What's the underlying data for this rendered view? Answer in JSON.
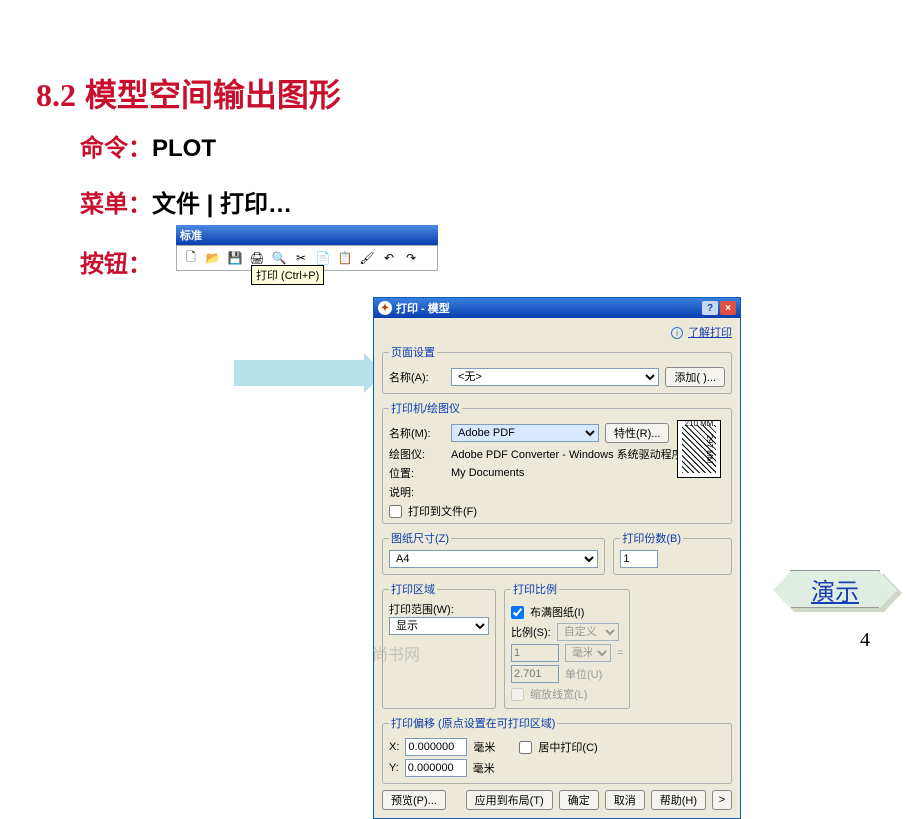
{
  "heading": {
    "number": "8.2",
    "title": "模型空间输出图形"
  },
  "lines": {
    "command_label": "命令：",
    "command_value": "PLOT",
    "menu_label": "菜单：",
    "menu_value": "文件 | 打印…",
    "button_label": "按钮："
  },
  "toolbar": {
    "title": "标准",
    "tooltip": "打印 (Ctrl+P)",
    "icons": [
      "new",
      "open",
      "save",
      "print",
      "preview",
      "cut",
      "copy",
      "paste",
      "props",
      "undo",
      "redo"
    ]
  },
  "dialog": {
    "title": "打印 - 模型",
    "help_btn": "?",
    "close_btn": "×",
    "learn_link": "了解打印",
    "page_setup": {
      "legend": "页面设置",
      "name_label": "名称(A):",
      "name_value": "<无>",
      "add_btn": "添加( )..."
    },
    "printer": {
      "legend": "打印机/绘图仪",
      "name_label": "名称(M):",
      "name_value": "Adobe PDF",
      "props_btn": "特性(R)...",
      "plotter_label": "绘图仪:",
      "plotter_value": "Adobe PDF Converter - Windows 系统驱动程序 ...",
      "where_label": "位置:",
      "where_value": "My Documents",
      "desc_label": "说明:",
      "tofile_label": "打印到文件(F)",
      "paper_w": "210 MM",
      "paper_h": "297 MM"
    },
    "paper_size": {
      "legend": "图纸尺寸(Z)",
      "value": "A4"
    },
    "copies": {
      "legend": "打印份数(B)",
      "value": "1"
    },
    "area": {
      "legend": "打印区域",
      "what_label": "打印范围(W):",
      "what_value": "显示"
    },
    "scale": {
      "legend": "打印比例",
      "fit_label": "布满图纸(I)",
      "ratio_label": "比例(S):",
      "ratio_value": "自定义",
      "mm_value": "1",
      "mm_unit": "毫米",
      "eq": "=",
      "unit_value": "2.701",
      "unit_unit": "单位(U)",
      "lineweights": "缩放线宽(L)"
    },
    "offset": {
      "legend": "打印偏移 (原点设置在可打印区域)",
      "x": "X:",
      "x_val": "0.000000",
      "y": "Y:",
      "y_val": "0.000000",
      "unit": "毫米",
      "center": "居中打印(C)"
    },
    "buttons": {
      "preview": "预览(P)...",
      "apply": "应用到布局(T)",
      "ok": "确定",
      "cancel": "取消",
      "help": "帮助(H)",
      "expand": ">"
    }
  },
  "demo_link": "演示",
  "page_number": "4",
  "watermark": "尚书网"
}
